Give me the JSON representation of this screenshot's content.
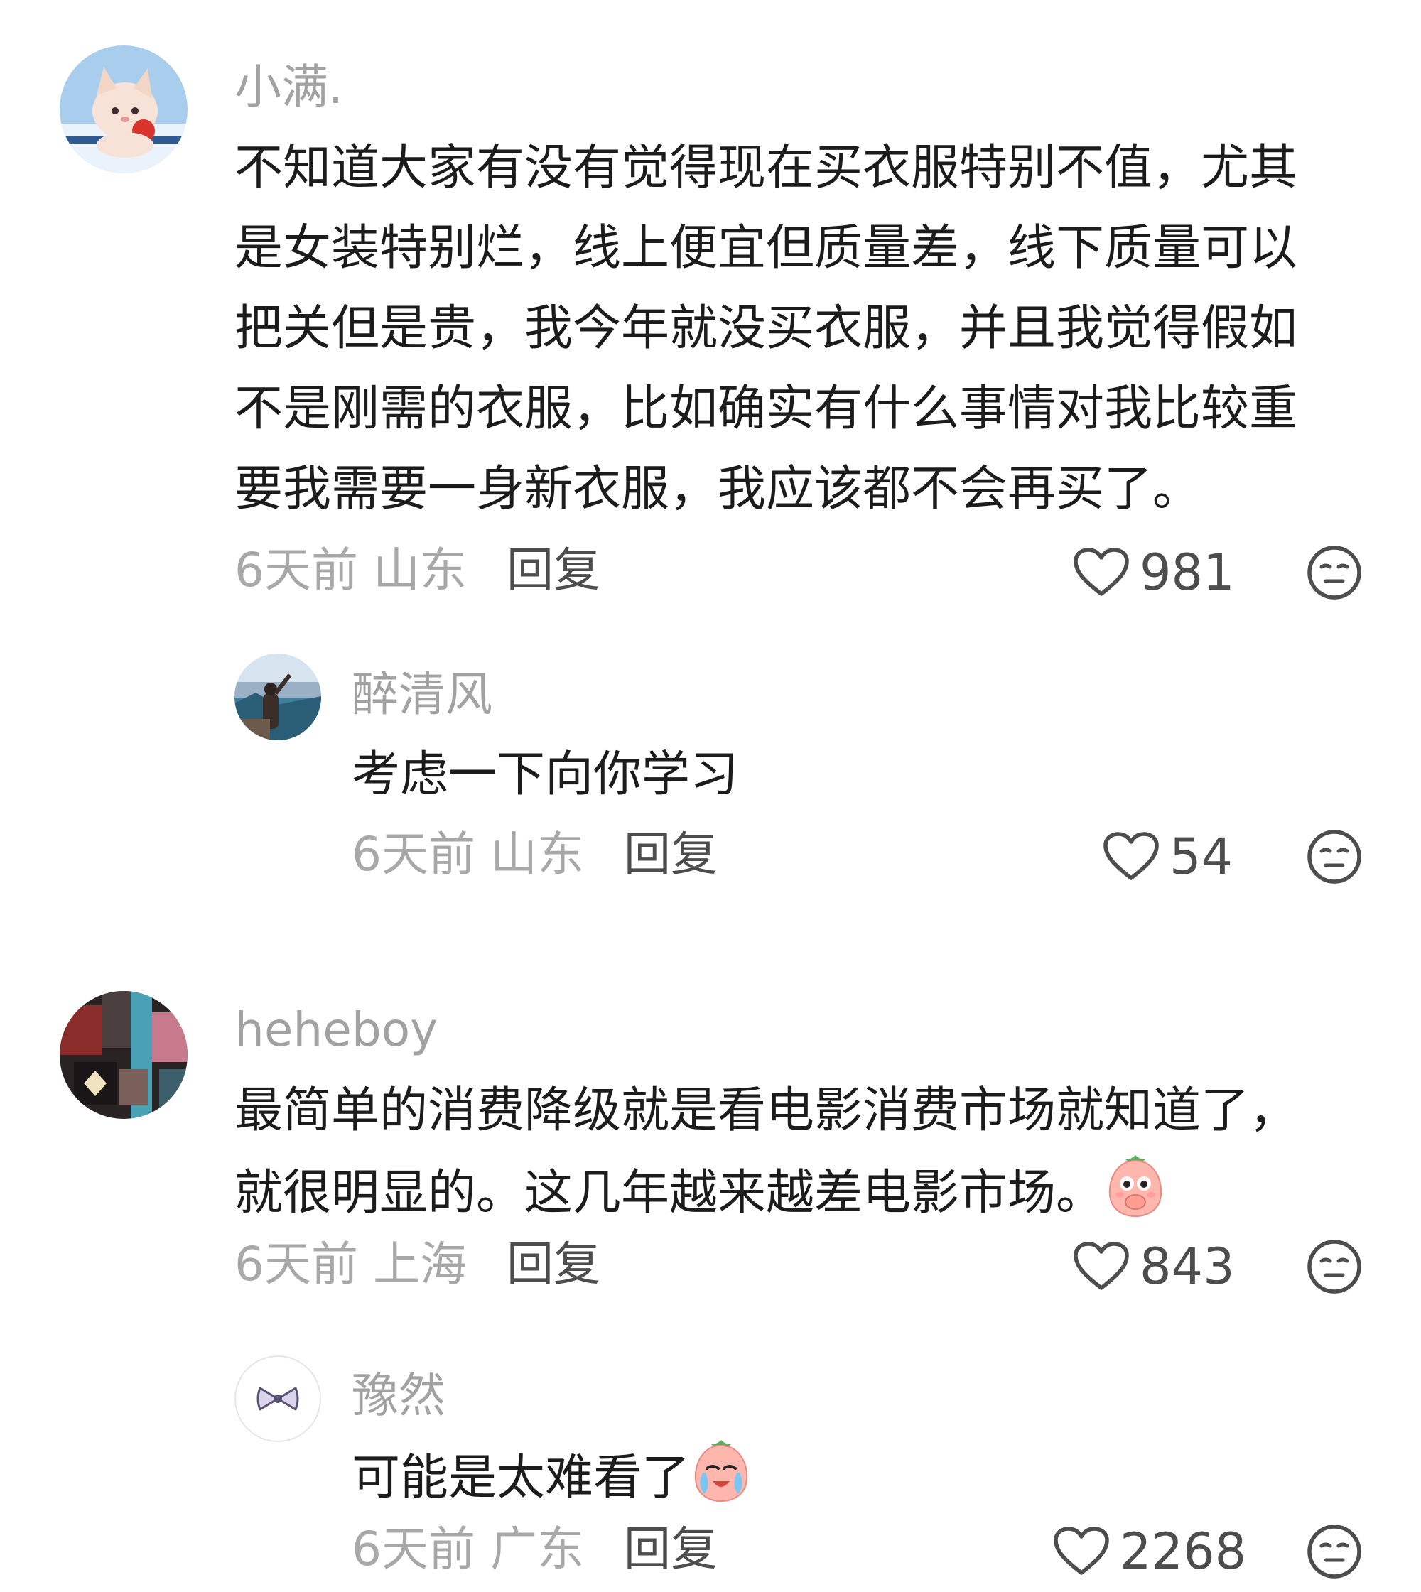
{
  "comments": [
    {
      "username": "小满.",
      "lines": [
        "不知道大家有没有觉得现在买衣服特别不值，尤其",
        "是女装特别烂，线上便宜但质量差，线下质量可以",
        "把关但是贵，我今年就没买衣服，并且我觉得假如",
        "不是刚需的衣服，比如确实有什么事情对我比较重",
        "要我需要一身新衣服，我应该都不会再买了。"
      ],
      "time_location": "6天前 山东",
      "reply_label": "回复",
      "like_count": "981",
      "avatar_icon": "plush-cat-avatar",
      "replies": [
        {
          "username": "醉清风",
          "text": "考虑一下向你学习",
          "time_location": "6天前 山东",
          "reply_label": "回复",
          "like_count": "54",
          "avatar_icon": "lake-photo-avatar"
        }
      ]
    },
    {
      "username": "heheboy",
      "lines": [
        "最简单的消费降级就是看电影消费市场就知道了，",
        "就很明显的。这几年越来越差电影市场。"
      ],
      "emoji": "peach-cover-mouth-emoji",
      "time_location": "6天前 上海",
      "reply_label": "回复",
      "like_count": "843",
      "avatar_icon": "collage-avatar",
      "replies": [
        {
          "username": "豫然",
          "text": "可能是太难看了",
          "emoji": "peach-crying-emoji",
          "time_location": "6天前 广东",
          "reply_label": "回复",
          "like_count": "2268",
          "avatar_icon": "bow-avatar"
        }
      ]
    }
  ],
  "icons": {
    "like": "heart-outline-icon",
    "dislike": "meh-face-icon"
  },
  "colors": {
    "username": "#a2a2a2",
    "text": "#1c1c1c",
    "meta": "#a8a8a8",
    "action": "#4d4d4d"
  }
}
